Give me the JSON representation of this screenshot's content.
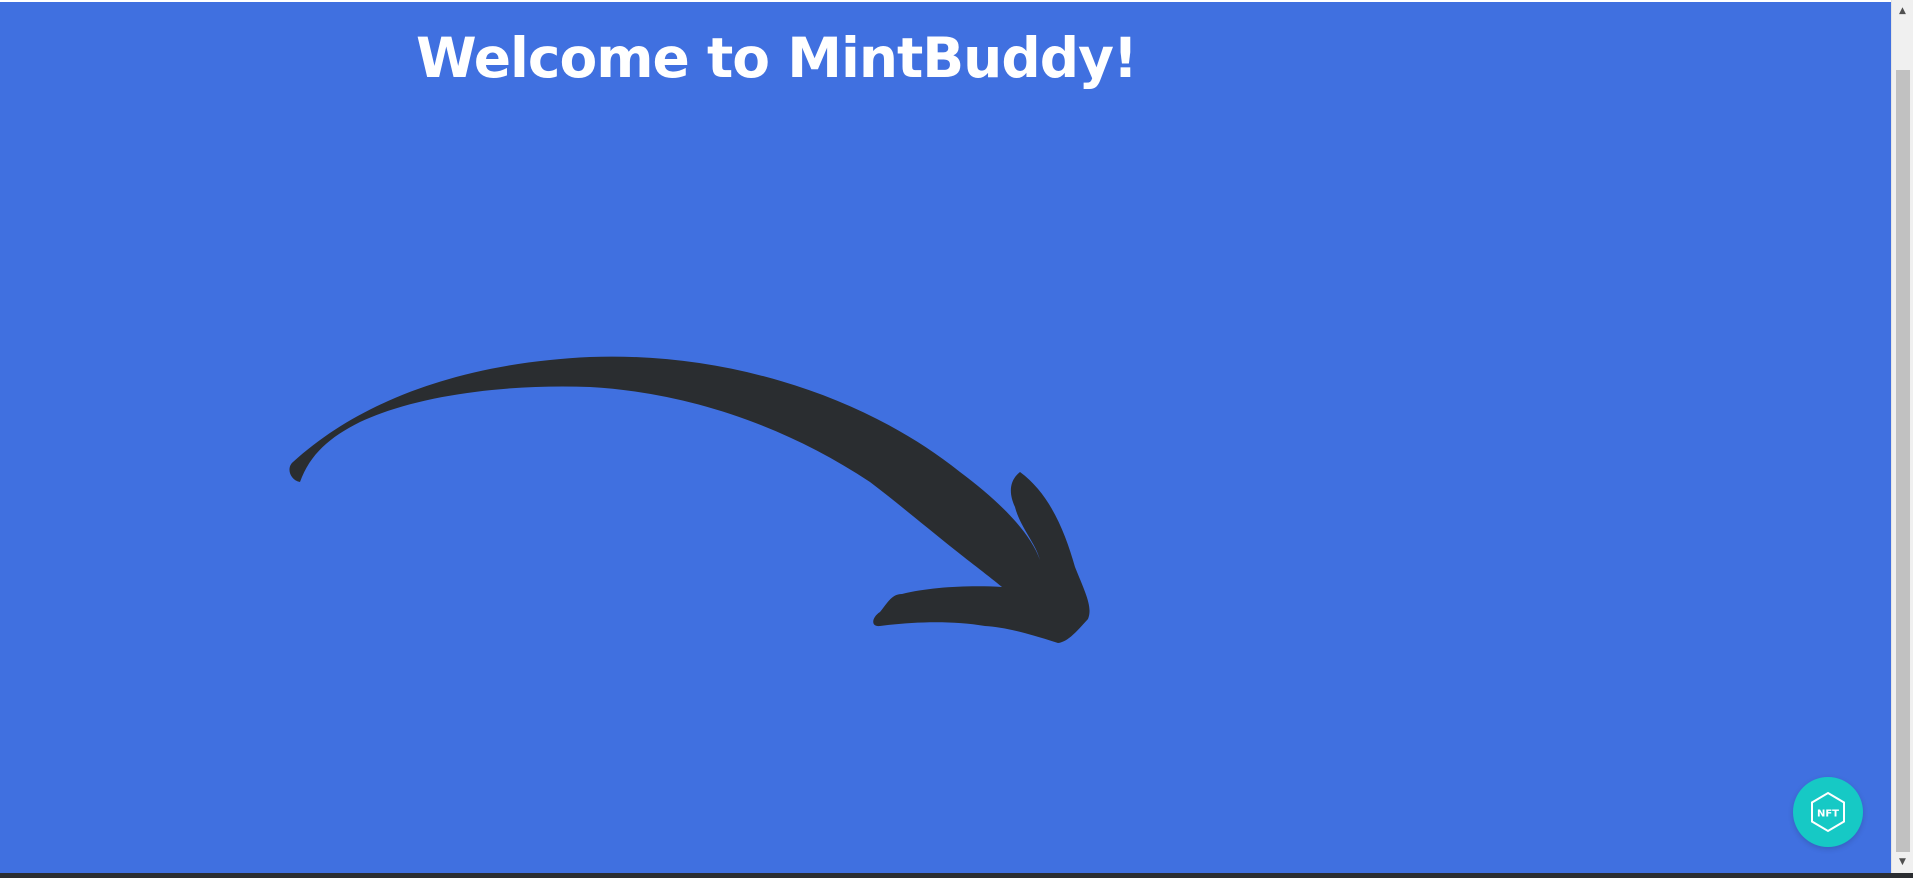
{
  "page": {
    "title": "Welcome to MintBuddy!",
    "background_color": "#4070e0"
  },
  "arrow": {
    "icon": "curved-arrow-icon",
    "color": "#2a2d30"
  },
  "nft_button": {
    "label": "NFT",
    "icon": "hexagon-icon",
    "color": "#16c9c5"
  },
  "scrollbar": {
    "up_glyph": "▲",
    "down_glyph": "▼"
  }
}
